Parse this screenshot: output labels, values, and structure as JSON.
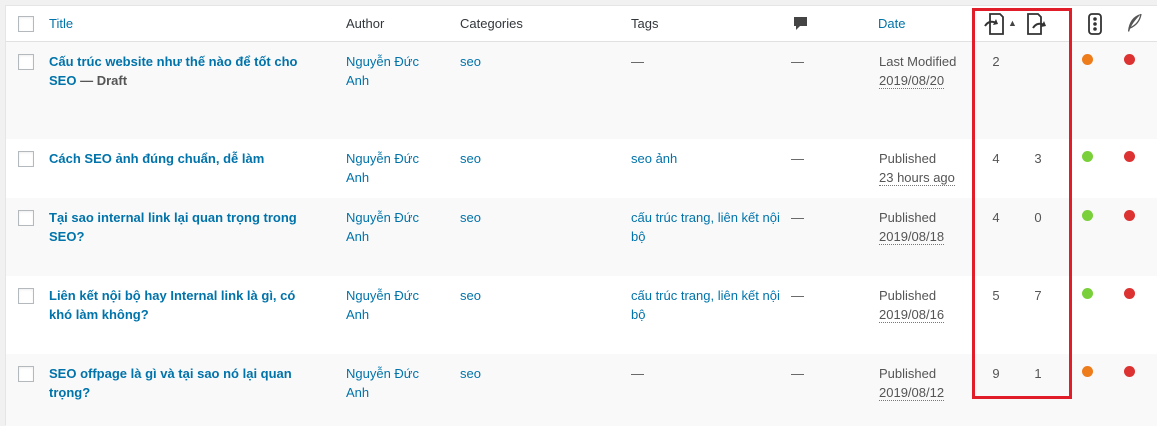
{
  "header": {
    "title": "Title",
    "author": "Author",
    "categories": "Categories",
    "tags": "Tags",
    "date": "Date",
    "sort_arrow": "▲"
  },
  "rows": [
    {
      "title": "Cấu trúc website như thế nào để tốt cho SEO",
      "title_line1": "Cấu trúc website như thế nào để tốt cho",
      "title_line2": "SEO",
      "state": " — Draft",
      "author_line1": "Nguyễn Đức",
      "author_line2": "Anh",
      "category": "seo",
      "tags_line1": "—",
      "tags_line2": "",
      "comments": "—",
      "date_status": "Last Modified",
      "date_value": "2019/08/20",
      "inbound": "2",
      "outbound": "",
      "readability": "#ee7c1b",
      "seo_score": "#dc3232"
    },
    {
      "title_line1": "Cách SEO ảnh đúng chuẩn, dễ làm",
      "title_line2": "",
      "state": "",
      "author_line1": "Nguyễn Đức",
      "author_line2": "Anh",
      "category": "seo",
      "tags_line1": "seo ảnh",
      "tags_line2": "",
      "comments": "—",
      "date_status": "Published",
      "date_value": "23 hours ago",
      "inbound": "4",
      "outbound": "3",
      "readability": "#7ad03a",
      "seo_score": "#dc3232"
    },
    {
      "title_line1": "Tại sao internal link lại quan trọng trong",
      "title_line2": "SEO?",
      "state": "",
      "author_line1": "Nguyễn Đức",
      "author_line2": "Anh",
      "category": "seo",
      "tags_line1": "cấu trúc trang, liên kết nội",
      "tags_line2": "bộ",
      "comments": "—",
      "date_status": "Published",
      "date_value": "2019/08/18",
      "inbound": "4",
      "outbound": "0",
      "readability": "#7ad03a",
      "seo_score": "#dc3232"
    },
    {
      "title_line1": "Liên kết nội bộ hay Internal link là gì, có",
      "title_line2": "khó làm không?",
      "state": "",
      "author_line1": "Nguyễn Đức",
      "author_line2": "Anh",
      "category": "seo",
      "tags_line1": "cấu trúc trang, liên kết nội",
      "tags_line2": "bộ",
      "comments": "—",
      "date_status": "Published",
      "date_value": "2019/08/16",
      "inbound": "5",
      "outbound": "7",
      "readability": "#7ad03a",
      "seo_score": "#dc3232"
    },
    {
      "title_line1": "SEO offpage là gì và tại sao nó lại quan",
      "title_line2": "trọng?",
      "state": "",
      "author_line1": "Nguyễn Đức",
      "author_line2": "Anh",
      "category": "seo",
      "tags_line1": "—",
      "tags_line2": "",
      "comments": "—",
      "date_status": "Published",
      "date_value": "2019/08/12",
      "inbound": "9",
      "outbound": "1",
      "readability": "#ee7c1b",
      "seo_score": "#dc3232"
    }
  ],
  "colors": {
    "link": "#0073aa",
    "highlight": "#e11d2a",
    "alt_row": "#f9f9f9"
  },
  "icons": {
    "comments": "comment-bubble-icon",
    "inbound_links": "inbound-links-icon",
    "outbound_links": "outbound-links-icon",
    "readability": "readability-traffic-light-icon",
    "seo": "yoast-feather-icon"
  }
}
